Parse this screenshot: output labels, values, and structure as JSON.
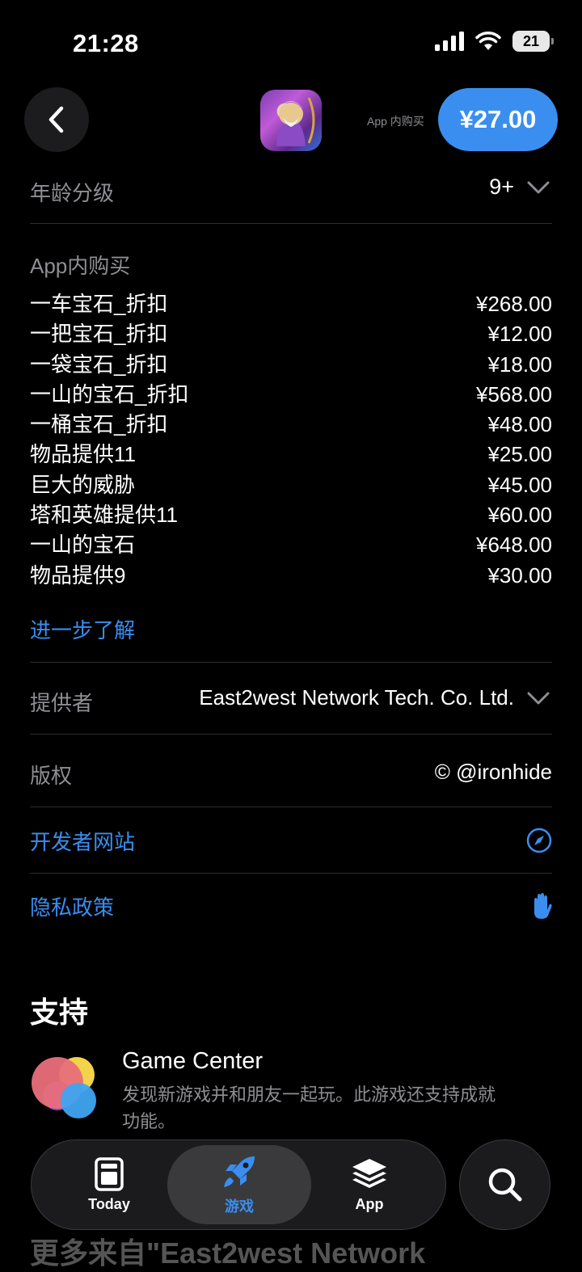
{
  "status_bar": {
    "time": "21:28",
    "battery": "21"
  },
  "header": {
    "iap_note": "App 内购买",
    "price": "¥27.00"
  },
  "age_rating": {
    "label": "年龄分级",
    "value": "9+"
  },
  "in_app_purchases": {
    "label": "App内购买",
    "items": [
      {
        "name": "一车宝石_折扣",
        "price": "¥268.00"
      },
      {
        "name": "一把宝石_折扣",
        "price": "¥12.00"
      },
      {
        "name": "一袋宝石_折扣",
        "price": "¥18.00"
      },
      {
        "name": "一山的宝石_折扣",
        "price": "¥568.00"
      },
      {
        "name": "一桶宝石_折扣",
        "price": "¥48.00"
      },
      {
        "name": "物品提供11",
        "price": "¥25.00"
      },
      {
        "name": "巨大的威胁",
        "price": "¥45.00"
      },
      {
        "name": "塔和英雄提供11",
        "price": "¥60.00"
      },
      {
        "name": "一山的宝石",
        "price": "¥648.00"
      },
      {
        "name": "物品提供9",
        "price": "¥30.00"
      }
    ],
    "learn_more": "进一步了解"
  },
  "provider": {
    "label": "提供者",
    "value": "East2west Network Tech. Co. Ltd."
  },
  "copyright": {
    "label": "版权",
    "value": "© @ironhide"
  },
  "developer_website": {
    "label": "开发者网站"
  },
  "privacy_policy": {
    "label": "隐私政策"
  },
  "support": {
    "title": "支持",
    "game_center": {
      "title": "Game Center",
      "description": "发现新游戏并和朋友一起玩。此游戏还支持成就功能。"
    }
  },
  "more_from": {
    "title": "更多来自\"East2west Network"
  },
  "tab_bar": {
    "tabs": [
      {
        "label": "Today"
      },
      {
        "label": "游戏"
      },
      {
        "label": "App"
      }
    ]
  },
  "colors": {
    "accent": "#3a8ef0",
    "background": "#000000",
    "secondary_text": "#8e8e93"
  }
}
